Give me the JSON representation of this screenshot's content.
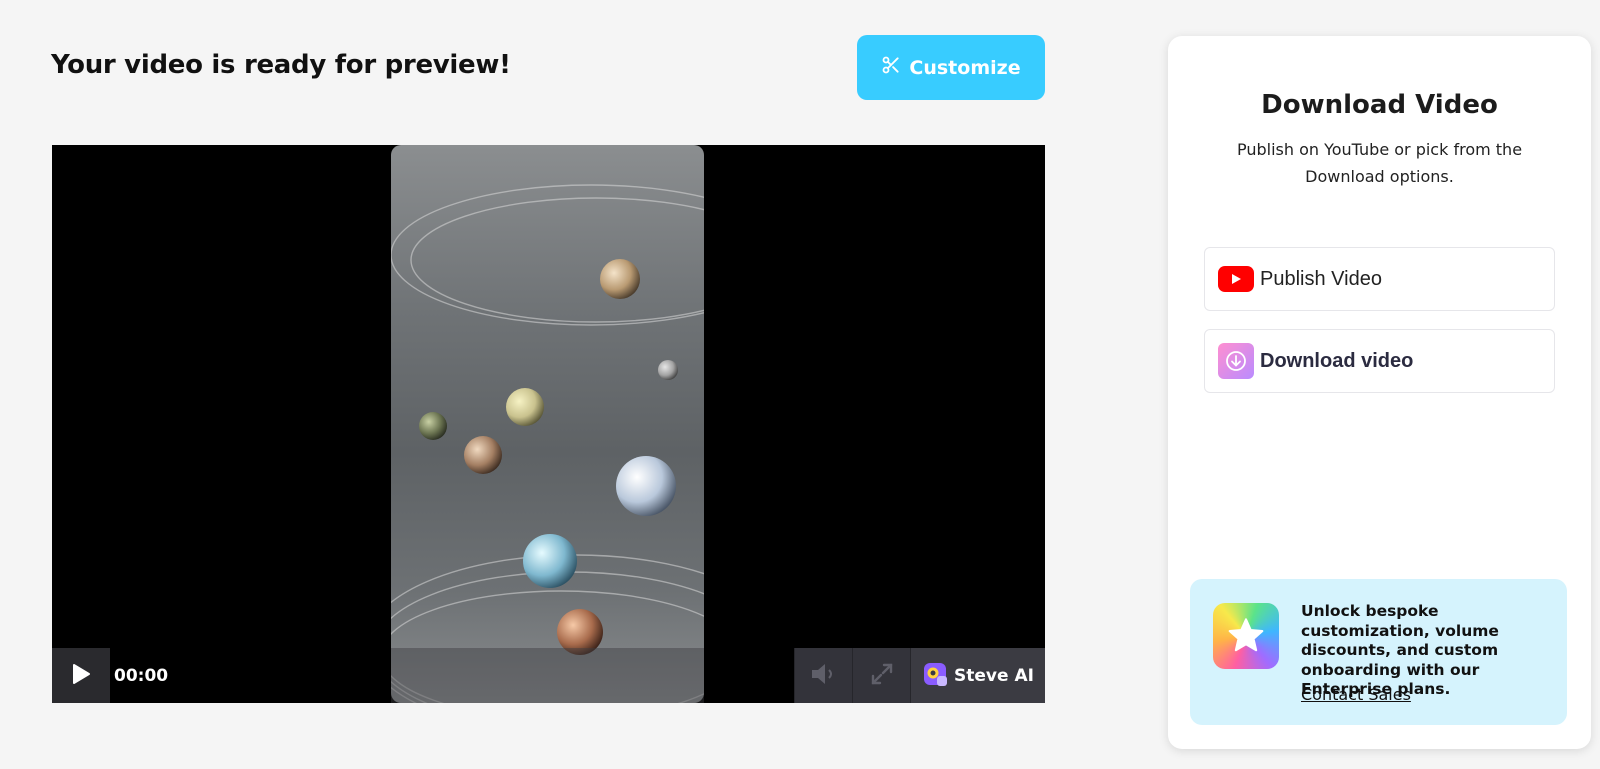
{
  "header": {
    "title": "Your video is ready for preview!",
    "customize_label": "Customize"
  },
  "player": {
    "time": "00:00",
    "brand": "Steve AI",
    "icons": {
      "play": "play-icon",
      "volume": "volume-icon",
      "fullscreen": "fullscreen-icon"
    }
  },
  "download_panel": {
    "title": "Download Video",
    "subtitle": "Publish on YouTube or pick from the Download options.",
    "publish_label": "Publish Video",
    "download_label": "Download video",
    "promo_text": "Unlock bespoke customization, volume discounts, and custom onboarding with our Enterprise plans.",
    "contact_link": "Contact Sales"
  },
  "colors": {
    "accent": "#38ccff",
    "youtube": "#ff0000",
    "promo_bg": "#d5f3fd",
    "page_bg": "#f5f5f5"
  }
}
